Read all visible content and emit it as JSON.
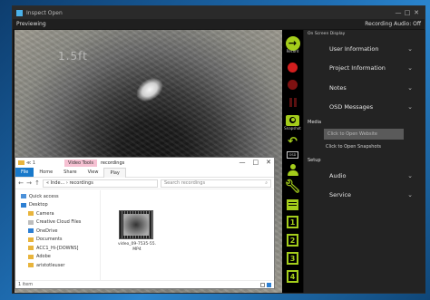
{
  "app": {
    "title": "Inspect Open",
    "status_left": "Previewing",
    "status_right": "Recording Audio: Off",
    "controls": [
      "—",
      "□",
      "✕"
    ]
  },
  "video": {
    "depth_overlay": "1.5ft"
  },
  "toolbar": {
    "record_label": "Record",
    "snapshot_label": "Snapshot",
    "osd_label": "OSD",
    "num_buttons": [
      "1",
      "2",
      "3",
      "4"
    ]
  },
  "panel": {
    "header": "On Screen Display",
    "rows": [
      {
        "label": "User Information",
        "chevron": "⌄"
      },
      {
        "label": "Project Information",
        "chevron": "⌄"
      },
      {
        "label": "Notes",
        "chevron": "⌄"
      },
      {
        "label": "OSD Messages",
        "chevron": "⌄"
      }
    ],
    "media_section": "Media",
    "open_website_button": "Click to Open Website",
    "open_snapshots_link": "Click to Open Snapshots",
    "setup_section": "Setup",
    "setup_rows": [
      {
        "label": "Audio",
        "chevron": "⌄"
      },
      {
        "label": "Service",
        "chevron": "⌄"
      }
    ]
  },
  "explorer": {
    "title_path": "≪ 1",
    "manage_tab": "Video Tools",
    "name": "recordings",
    "ribbon_file": "File",
    "ribbon_tabs": [
      "Home",
      "Share",
      "View",
      "Play"
    ],
    "address_path": "« Inde... › recordings",
    "search_placeholder": "Search recordings",
    "tree": [
      {
        "label": "Quick access",
        "kind": "pc",
        "level": 1
      },
      {
        "label": "Desktop",
        "kind": "blue",
        "level": 1
      },
      {
        "label": "Camera",
        "kind": "folder",
        "level": 2
      },
      {
        "label": "Creative Cloud Files",
        "kind": "cloud",
        "level": 2
      },
      {
        "label": "OneDrive",
        "kind": "blue",
        "level": 2
      },
      {
        "label": "Documents",
        "kind": "folder",
        "level": 2
      },
      {
        "label": "ACC1_Hi-[DOWNS]",
        "kind": "folder",
        "level": 2
      },
      {
        "label": "Adobe",
        "kind": "folder",
        "level": 2
      },
      {
        "label": "aristotleuser",
        "kind": "folder",
        "level": 2
      }
    ],
    "file_label": "video_09-7535-55.MP4",
    "status_count": "1 item"
  }
}
